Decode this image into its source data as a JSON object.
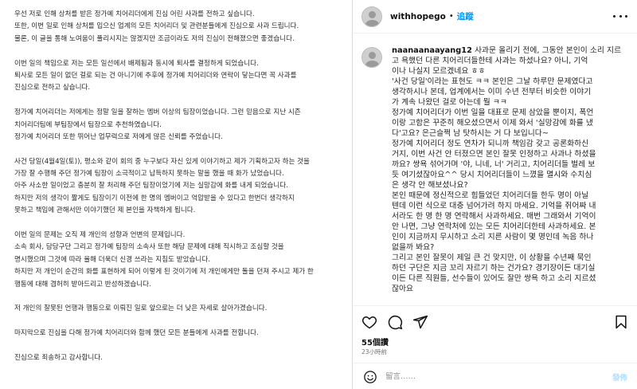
{
  "letter": {
    "lines": [
      "우선 저로 인해 상처를 받은 정가예 치어리더에게 진심 어린 사과를 전하고 싶습니다.",
      "또한, 이번 일로 인해 상처를 입으신 업계의 모든 치어리더 및 관련분들에게 진심으로 사과 드립니다.",
      "물론, 이 글을 통해 노여움이 풀리시지는 않겠지만 조금이라도 저의 진심이 전해졌으면 좋겠습니다.",
      "",
      "이번 일의 책임으로 저는 모든 일선에서 배제됨과 동시에 퇴사를 결정하게 되었습니다.",
      "퇴사로 모든 일이 없던 걸로 되는 건 아니기에  추후에 정가예 치어리더와 연락이 닿는다면 꼭 사과를",
      "진심으로 전하고 싶습니다.",
      "",
      "정가예 치어리더는 저에게는 정말 일을 잘하는 멤버 이상의 팀장이었습니다. 그런 믿음으로 지난 시즌",
      "치어리더팀에 부팀장에서 팀장으로 추천하였습니다.",
      "정가예 치어리더 또한 뛰어난 업무력으로 저에게 많은 신뢰를 주었습니다.",
      "",
      "사건 당일(4월4일(토)), 평소와 같이 회의 중 누구보다 자신 있게 이야기하고 제가 기획하고자 하는 것을",
      "가장 잘 수행해 주던 정가예 팀장이 소극적이고  납득하지 못하는 말을 했을 때 화가 났었습니다.",
      "아주 사소한 일이었고 충분히 잘 처리해 주던 팀장이었기에 저는 실망감에 화를 내게 되었습니다.",
      "하지만 저의 생각이 짧게도 팀장이기 이전에 한 명의 멤버이고 억압받을 수 있다고 한번더 생각하지",
      "못하고 책임에 관해서만 이야기했던 제 본인을 자책하게 됩니다.",
      "",
      "이번 일의 문제는 오직 제 개인의 성향과 언변의 문제입니다.",
      "소속 회사, 담당구단 그리고 정가예 팀장의 소속사 또한 해당 문제에 대해 직시하고 조심할 것을",
      "명시했으며 그것에 따라 율해 더욱더 신경 쓰라는 지침도 받았습니다.",
      "하지만 저 개인이 순간의 화를 표현하게 되어 이렇게 된 것이기에 저 개인에게만 돌을 던져 주시고 제가 한",
      "행동에 대해 겸허히 받아드리고 반성하겠습니다.",
      "",
      "저 개인의 잘못된 언행과 행동으로 이뤄진 일로 앞으로는 더 낮은 자세로 살아가겠습니다.",
      "",
      "마지막으로 진심을 다해 정가예 치어리더와 함께 했던 모든 분들에게 사과를 전합니다.",
      "",
      "진심으로 죄송하고 감사합니다."
    ]
  },
  "header": {
    "username": "withhopego",
    "separator": "•",
    "follow_label": "追蹤"
  },
  "comment": {
    "username": "naanaanaayang12",
    "lines": [
      "사과문 올리기 전에, 그동안 본인이 소리 지르",
      "고 욕했던 다른 치어리더들한테 사과는 하셨나요? 아니, 기억",
      "이나 나실지 모르겠네요 ㅎㅎ",
      "'사건 당일'이라는 표현도 ㅋㅋ 본인은 그날 하루만 문제였다고",
      "생각하시나 본데, 업계에서는 이미 수년 전부터 비슷한 이야기",
      "가 계속 나왔던 걸로 아는데 뭘 ㅋㅋ",
      "정가예 치어리더가 이번 일을 대표로 문제 삼았을 뿐이지, 폭언",
      "이랑 고함은 꾸준히 해오셨으면서 이제 와서 '실망감에 화를 냈",
      "다'고요? 은근슬쩍 남 탓하시는 거 다 보입니다~",
      "정가예 치어리더 정도 연차가 되니까 책임감 갖고 공론화하신",
      "거지, 이번 사건 안 터졌으면 본인 잘못 인정하고 사과나 하셨을",
      "까요? 쌍욕 섞어가며 '야, 니네, 너' 거리고, 치어리더들 벌레 보",
      "듯 여기셨잖아요^^ 당시 치어리더들이 느꼈을 멸시와 수치심",
      "은 생각 안 해보셨나요?",
      "본인 때문에 정신적으로 힘들었던 치어리더들 한두 명이 아닐",
      "텐데 이런 식으로 대충 넘어가려 하지 마세요. 기억을 쥐어짜 내",
      "서라도 한 명 한 명 연락해서 사과하세요. 매번 그래와서 기억이",
      "안 나면, 그냥 연락처에 있는 모든 치어리더한테 사과하세요. 본",
      "인이 지금까지 무시하고 소리 지른 사람이 몇 명인데 녹음 하나",
      "없을까 봐요?",
      "그리고 본인 잘못이 제일 큰 건 맞지만, 이 상황을 수년째 묵인",
      "하던 구단은 지금 꼬리 자르기 하는 건가요? 경기장이든 대기실",
      "이든 다른 직원들, 선수들이 있어도 잘만 쌍욕 하고 소리 지르셨",
      "잖아요"
    ]
  },
  "actions": {
    "icons": [
      "heart-icon",
      "comment-icon",
      "share-icon",
      "bookmark-icon"
    ],
    "likes": "55個讚",
    "timestamp": "23小時前"
  },
  "comment_box": {
    "placeholder": "留言……",
    "post_label": "發佈"
  },
  "colors": {
    "accent": "#0095f6",
    "post_disabled": "#b2dffc",
    "muted": "#737373",
    "divider": "#dbdbdb"
  }
}
